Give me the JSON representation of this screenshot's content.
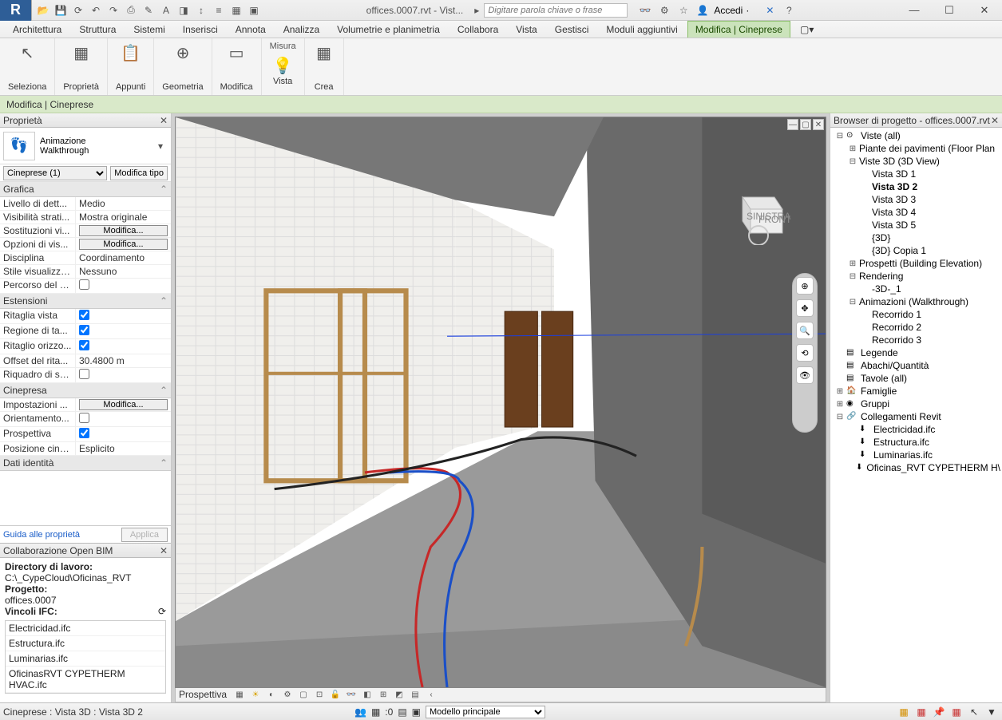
{
  "titlebar": {
    "doc_title": "offices.0007.rvt - Vist...",
    "search_placeholder": "Digitare parola chiave o frase",
    "login_label": "Accedi"
  },
  "ribbon_tabs": [
    "Architettura",
    "Struttura",
    "Sistemi",
    "Inserisci",
    "Annota",
    "Analizza",
    "Volumetrie e planimetria",
    "Collabora",
    "Vista",
    "Gestisci",
    "Moduli aggiuntivi",
    "Modifica | Cineprese"
  ],
  "active_tab": "Modifica | Cineprese",
  "ribbon_groups": [
    {
      "icon": "↖",
      "label": "Seleziona"
    },
    {
      "icon": "▦",
      "label": "Proprietà"
    },
    {
      "icon": "📋",
      "label": "Appunti"
    },
    {
      "icon": "⊕",
      "label": "Geometria"
    },
    {
      "icon": "▭",
      "label": "Modifica"
    },
    {
      "icon": "💡",
      "label": "Vista",
      "top": "Misura"
    },
    {
      "icon": "▦",
      "label": "Crea"
    }
  ],
  "ctx_bar": "Modifica | Cineprese",
  "properties": {
    "panel_title": "Proprietà",
    "type_cat": "Animazione",
    "type_name": "Walkthrough",
    "selector": "Cineprese (1)",
    "edit_type": "Modifica tipo",
    "help_link": "Guida alle proprietà",
    "apply": "Applica",
    "categories": [
      {
        "name": "Grafica",
        "rows": [
          {
            "k": "Livello di dett...",
            "v": "Medio",
            "type": "text"
          },
          {
            "k": "Visibilità strati...",
            "v": "Mostra originale",
            "type": "text"
          },
          {
            "k": "Sostituzioni vi...",
            "v": "Modifica...",
            "type": "btn"
          },
          {
            "k": "Opzioni di vis...",
            "v": "Modifica...",
            "type": "btn"
          },
          {
            "k": "Disciplina",
            "v": "Coordinamento",
            "type": "text"
          },
          {
            "k": "Stile visualizza...",
            "v": "Nessuno",
            "type": "text"
          },
          {
            "k": "Percorso del s...",
            "v": "",
            "type": "chk",
            "checked": false
          }
        ]
      },
      {
        "name": "Estensioni",
        "rows": [
          {
            "k": "Ritaglia vista",
            "v": "",
            "type": "chk",
            "checked": true
          },
          {
            "k": "Regione di ta...",
            "v": "",
            "type": "chk",
            "checked": true
          },
          {
            "k": "Ritaglio orizzo...",
            "v": "",
            "type": "chk",
            "checked": true
          },
          {
            "k": "Offset del rita...",
            "v": "30.4800 m",
            "type": "text"
          },
          {
            "k": "Riquadro di se...",
            "v": "",
            "type": "chk",
            "checked": false
          }
        ]
      },
      {
        "name": "Cinepresa",
        "rows": [
          {
            "k": "Impostazioni ...",
            "v": "Modifica...",
            "type": "btn"
          },
          {
            "k": "Orientamento...",
            "v": "",
            "type": "chk",
            "checked": false
          },
          {
            "k": "Prospettiva",
            "v": "",
            "type": "chk",
            "checked": true
          },
          {
            "k": "Posizione cine...",
            "v": "Esplicito",
            "type": "text"
          }
        ]
      },
      {
        "name": "Dati identità",
        "rows": []
      }
    ]
  },
  "bim": {
    "panel_title": "Collaborazione Open BIM",
    "dir_label": "Directory di lavoro:",
    "dir_value": "C:\\_CypeCloud\\Oficinas_RVT",
    "proj_label": "Progetto:",
    "proj_value": "offices.0007",
    "vinc_label": "Vincoli IFC:",
    "links": [
      "Electricidad.ifc",
      "Estructura.ifc",
      "Luminarias.ifc",
      "OficinasRVT CYPETHERM HVAC.ifc"
    ]
  },
  "viewport": {
    "cube_left": "SINISTRA",
    "cube_front": "FRONTE",
    "ctrl_label": "Prospettiva"
  },
  "browser": {
    "panel_title": "Browser di progetto - offices.0007.rvt",
    "tree": [
      {
        "lvl": 0,
        "tw": "⊟",
        "icon": "⊙",
        "label": "Viste (all)"
      },
      {
        "lvl": 1,
        "tw": "⊞",
        "icon": "",
        "label": "Piante dei pavimenti (Floor Plan"
      },
      {
        "lvl": 1,
        "tw": "⊟",
        "icon": "",
        "label": "Viste 3D (3D View)"
      },
      {
        "lvl": 2,
        "tw": "",
        "icon": "",
        "label": "Vista 3D 1"
      },
      {
        "lvl": 2,
        "tw": "",
        "icon": "",
        "label": "Vista 3D 2",
        "bold": true
      },
      {
        "lvl": 2,
        "tw": "",
        "icon": "",
        "label": "Vista 3D 3"
      },
      {
        "lvl": 2,
        "tw": "",
        "icon": "",
        "label": "Vista 3D 4"
      },
      {
        "lvl": 2,
        "tw": "",
        "icon": "",
        "label": "Vista 3D 5"
      },
      {
        "lvl": 2,
        "tw": "",
        "icon": "",
        "label": "{3D}"
      },
      {
        "lvl": 2,
        "tw": "",
        "icon": "",
        "label": "{3D} Copia 1"
      },
      {
        "lvl": 1,
        "tw": "⊞",
        "icon": "",
        "label": "Prospetti (Building Elevation)"
      },
      {
        "lvl": 1,
        "tw": "⊟",
        "icon": "",
        "label": "Rendering"
      },
      {
        "lvl": 2,
        "tw": "",
        "icon": "",
        "label": "-3D-_1"
      },
      {
        "lvl": 1,
        "tw": "⊟",
        "icon": "",
        "label": "Animazioni (Walkthrough)"
      },
      {
        "lvl": 2,
        "tw": "",
        "icon": "",
        "label": "Recorrido 1"
      },
      {
        "lvl": 2,
        "tw": "",
        "icon": "",
        "label": "Recorrido 2"
      },
      {
        "lvl": 2,
        "tw": "",
        "icon": "",
        "label": "Recorrido 3"
      },
      {
        "lvl": 0,
        "tw": "",
        "icon": "▤",
        "label": "Legende"
      },
      {
        "lvl": 0,
        "tw": "",
        "icon": "▤",
        "label": "Abachi/Quantità"
      },
      {
        "lvl": 0,
        "tw": "",
        "icon": "▤",
        "label": "Tavole (all)"
      },
      {
        "lvl": 0,
        "tw": "⊞",
        "icon": "🏠",
        "label": "Famiglie"
      },
      {
        "lvl": 0,
        "tw": "⊞",
        "icon": "◉",
        "label": "Gruppi"
      },
      {
        "lvl": 0,
        "tw": "⊟",
        "icon": "🔗",
        "label": "Collegamenti Revit"
      },
      {
        "lvl": 1,
        "tw": "",
        "icon": "⬇",
        "label": "Electricidad.ifc"
      },
      {
        "lvl": 1,
        "tw": "",
        "icon": "⬇",
        "label": "Estructura.ifc"
      },
      {
        "lvl": 1,
        "tw": "",
        "icon": "⬇",
        "label": "Luminarias.ifc"
      },
      {
        "lvl": 1,
        "tw": "",
        "icon": "⬇",
        "label": "Oficinas_RVT CYPETHERM H\\"
      }
    ]
  },
  "statusbar": {
    "left": "Cineprese : Vista 3D : Vista 3D 2",
    "zero_label": ":0",
    "model_combo": "Modello principale"
  }
}
